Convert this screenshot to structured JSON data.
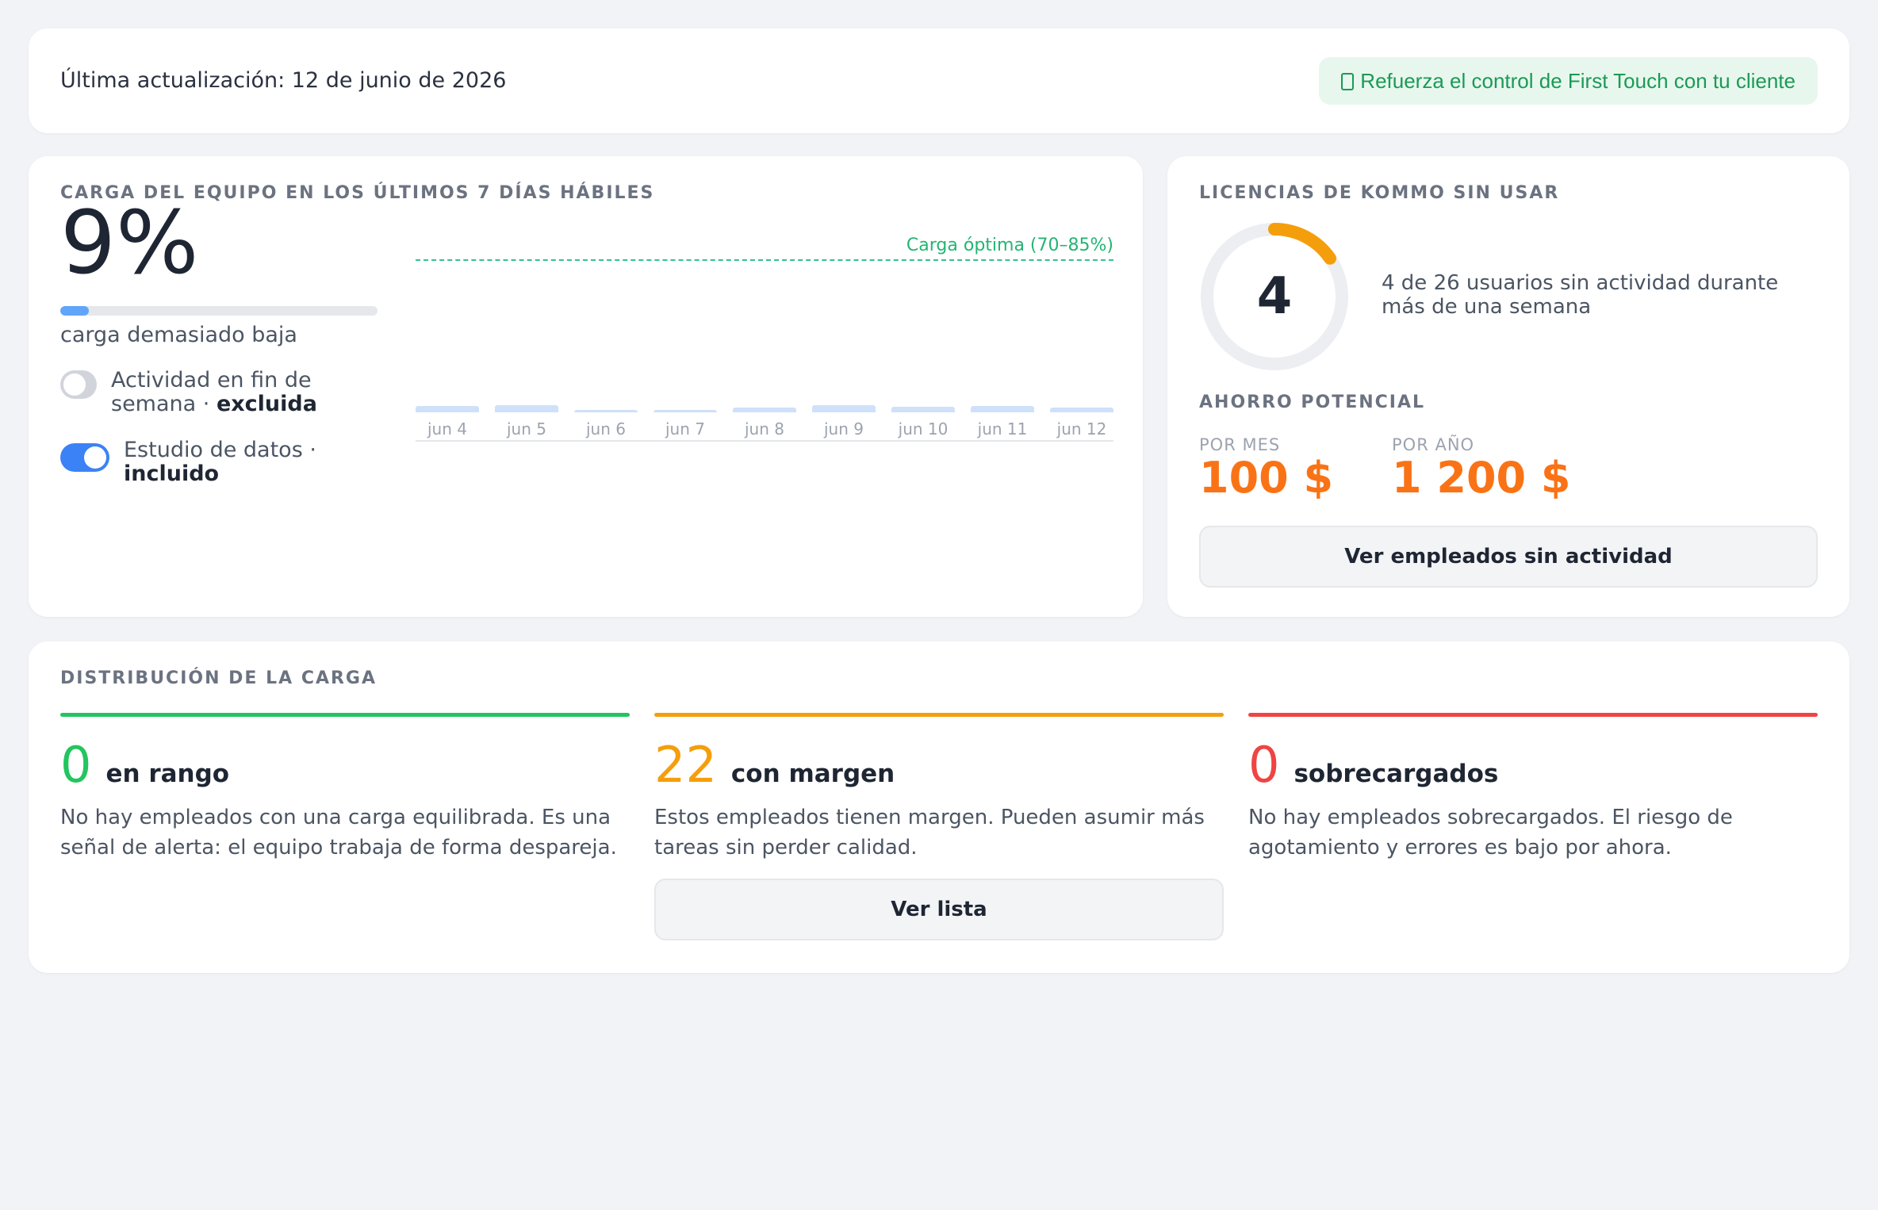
{
  "header": {
    "last_update": "Última actualización: 12 de junio de 2026",
    "first_touch_button": "Refuerza el control de First Touch con tu cliente"
  },
  "load": {
    "title": "CARGA DEL EQUIPO EN LOS ÚLTIMOS 7 DÍAS HÁBILES",
    "percent_text": "9%",
    "percent_value": 9,
    "status": "carga demasiado baja",
    "weekend_toggle": {
      "label": "Actividad en fin de semana · ",
      "state": "excluida",
      "on": false
    },
    "data_study_toggle": {
      "label": "Estudio de datos · ",
      "state": "incluido",
      "on": true
    }
  },
  "chart_data": {
    "type": "bar",
    "categories": [
      "jun 4",
      "jun 5",
      "jun 6",
      "jun 7",
      "jun 8",
      "jun 9",
      "jun 10",
      "jun 11",
      "jun 12"
    ],
    "values": [
      12,
      13,
      2,
      2,
      9,
      14,
      11,
      12,
      9
    ],
    "ylim": [
      0,
      100
    ],
    "reference_band": {
      "label": "Carga óptima (70–85%)",
      "from": 70,
      "to": 85
    },
    "grid": false,
    "bar_color": "#cfe1fa"
  },
  "licenses": {
    "title": "LICENCIAS DE KOMMO SIN USAR",
    "unused": "4",
    "unused_count": 4,
    "total_count": 26,
    "description": "4 de 26 usuarios sin actividad durante más de una semana",
    "savings_title": "AHORRO POTENCIAL",
    "per_month_label": "POR MES",
    "per_month_value": "100 $",
    "per_year_label": "POR AÑO",
    "per_year_value": "1 200 $",
    "inactive_button": "Ver empleados sin actividad",
    "ring_color": "#f59e0b"
  },
  "distribution": {
    "title": "DISTRIBUCIÓN DE LA CARGA",
    "in_range": {
      "count": "0",
      "label": "en rango",
      "description": "No hay empleados con una carga equilibrada. Es una señal de alerta: el equipo trabaja de forma despareja.",
      "color": "#22c55e"
    },
    "with_margin": {
      "count": "22",
      "label": "con margen",
      "description": "Estos empleados tienen margen. Pueden asumir más tareas sin perder calidad.",
      "color": "#f59e0b",
      "button": "Ver lista"
    },
    "overloaded": {
      "count": "0",
      "label": "sobrecargados",
      "description": "No hay empleados sobrecargados. El riesgo de agotamiento y errores es bajo por ahora.",
      "color": "#ef4444"
    }
  }
}
